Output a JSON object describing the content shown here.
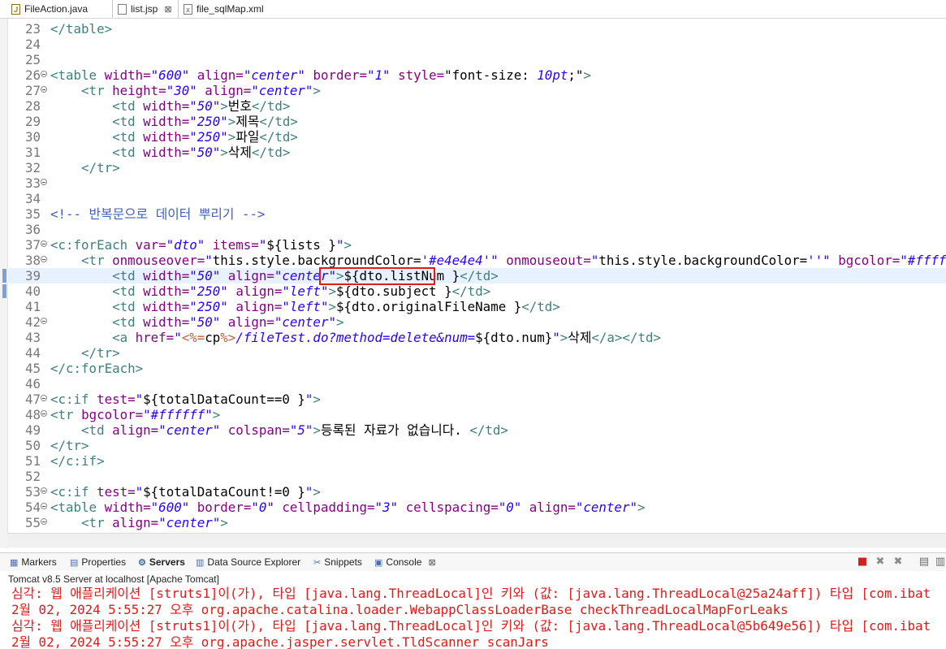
{
  "editor_tabs": [
    {
      "name": "FileAction.java",
      "icon": "java-file-icon",
      "active": false
    },
    {
      "name": "list.jsp",
      "icon": "jsp-file-icon",
      "active": true,
      "close": "⊠"
    },
    {
      "name": "file_sqlMap.xml",
      "icon": "xml-file-icon",
      "active": false
    }
  ],
  "editor": {
    "current_line": 39,
    "highlight_text": "${dto.listNum }",
    "lines": [
      {
        "n": "23",
        "fold": false,
        "html": "<span class='t'>&lt;/table&gt;</span>"
      },
      {
        "n": "24",
        "fold": false,
        "html": ""
      },
      {
        "n": "25",
        "fold": false,
        "html": ""
      },
      {
        "n": "26",
        "fold": true,
        "html": "<span class='t'>&lt;table</span> <span class='a'>width=</span><span class='v'>\"600\"</span> <span class='a'>align=</span><span class='v'>\"center\"</span> <span class='a'>border=</span><span class='v'>\"1\"</span> <span class='a'>style=</span><span class='d'>\"font-size: </span><span class='v'>10pt</span><span class='d'>;\"</span><span class='t'>&gt;</span>"
      },
      {
        "n": "27",
        "fold": true,
        "html": "    <span class='t'>&lt;tr</span> <span class='a'>height=</span><span class='v'>\"30\"</span> <span class='a'>align=</span><span class='v'>\"center\"</span><span class='t'>&gt;</span>"
      },
      {
        "n": "28",
        "fold": false,
        "html": "        <span class='t'>&lt;td</span> <span class='a'>width=</span><span class='v'>\"50\"</span><span class='t'>&gt;</span>번호<span class='t'>&lt;/td&gt;</span>"
      },
      {
        "n": "29",
        "fold": false,
        "html": "        <span class='t'>&lt;td</span> <span class='a'>width=</span><span class='v'>\"250\"</span><span class='t'>&gt;</span>제목<span class='t'>&lt;/td&gt;</span>"
      },
      {
        "n": "30",
        "fold": false,
        "html": "        <span class='t'>&lt;td</span> <span class='a'>width=</span><span class='v'>\"250\"</span><span class='t'>&gt;</span>파일<span class='t'>&lt;/td&gt;</span>"
      },
      {
        "n": "31",
        "fold": false,
        "html": "        <span class='t'>&lt;td</span> <span class='a'>width=</span><span class='v'>\"50\"</span><span class='t'>&gt;</span>삭제<span class='t'>&lt;/td&gt;</span>"
      },
      {
        "n": "32",
        "fold": false,
        "html": "    <span class='t'>&lt;/tr&gt;</span>"
      },
      {
        "n": "33",
        "fold": true,
        "html": ""
      },
      {
        "n": "34",
        "fold": false,
        "html": ""
      },
      {
        "n": "35",
        "fold": false,
        "html": "<span class='c'>&lt;!-- 반복문으로 데이터 뿌리기 --&gt;</span>"
      },
      {
        "n": "36",
        "fold": false,
        "html": ""
      },
      {
        "n": "37",
        "fold": true,
        "html": "<span class='t'>&lt;c:forEach</span> <span class='a'>var=</span><span class='v'>\"dto\"</span> <span class='a'>items=</span><span class='v'>\"</span><span class='d'>${lists }</span><span class='v'>\"</span><span class='t'>&gt;</span>"
      },
      {
        "n": "38",
        "fold": true,
        "html": "    <span class='t'>&lt;tr</span> <span class='a'>onmouseover=</span><span class='v'>\"</span><span class='d'>this.style.backgroundColor=</span><span class='v'>'#e4e4e4'</span><span class='v'>\"</span> <span class='a'>onmouseout=</span><span class='v'>\"</span><span class='d'>this.style.backgroundColor=</span><span class='v'>''</span><span class='v'>\"</span> <span class='a'>bgcolor=</span><span class='v'>\"#ffffff\"</span><span class='t'>&gt;</span>"
      },
      {
        "n": "39",
        "fold": false,
        "html": "        <span class='t'>&lt;td</span> <span class='a'>width=</span><span class='v'>\"50\"</span> <span class='a'>align=</span><span class='v'>\"center\"</span><span class='t'>&gt;</span>${dto.listNum }<span class='t'>&lt;/td&gt;</span>"
      },
      {
        "n": "40",
        "fold": false,
        "html": "        <span class='t'>&lt;td</span> <span class='a'>width=</span><span class='v'>\"250\"</span> <span class='a'>align=</span><span class='v'>\"left\"</span><span class='t'>&gt;</span>${dto.subject }<span class='t'>&lt;/td&gt;</span>"
      },
      {
        "n": "41",
        "fold": false,
        "html": "        <span class='t'>&lt;td</span> <span class='a'>width=</span><span class='v'>\"250\"</span> <span class='a'>align=</span><span class='v'>\"left\"</span><span class='t'>&gt;</span>${dto.originalFileName }<span class='t'>&lt;/td&gt;</span>"
      },
      {
        "n": "42",
        "fold": true,
        "html": "        <span class='t'>&lt;td</span> <span class='a'>width=</span><span class='v'>\"50\"</span> <span class='a'>align=</span><span class='v'>\"center\"</span><span class='t'>&gt;</span>"
      },
      {
        "n": "43",
        "fold": false,
        "html": "        <span class='t'>&lt;a</span> <span class='a'>href=</span><span class='v'>\"</span><span class='k'>&lt;%=</span><span class='d'>cp</span><span class='k'>%&gt;</span><span class='v'>/fileTest.do?method=delete&amp;num=</span><span class='d'>${dto.num}</span><span class='v'>\"</span><span class='t'>&gt;</span>삭제<span class='t'>&lt;/a&gt;&lt;/td&gt;</span>"
      },
      {
        "n": "44",
        "fold": false,
        "html": "    <span class='t'>&lt;/tr&gt;</span>"
      },
      {
        "n": "45",
        "fold": false,
        "html": "<span class='t'>&lt;/c:forEach&gt;</span>"
      },
      {
        "n": "46",
        "fold": false,
        "html": ""
      },
      {
        "n": "47",
        "fold": true,
        "html": "<span class='t'>&lt;c:if</span> <span class='a'>test=</span><span class='v'>\"</span><span class='d'>${totalDataCount==0 }</span><span class='v'>\"</span><span class='t'>&gt;</span>"
      },
      {
        "n": "48",
        "fold": true,
        "html": "<span class='t'>&lt;tr</span> <span class='a'>bgcolor=</span><span class='v'>\"#ffffff\"</span><span class='t'>&gt;</span>"
      },
      {
        "n": "49",
        "fold": false,
        "html": "    <span class='t'>&lt;td</span> <span class='a'>align=</span><span class='v'>\"center\"</span> <span class='a'>colspan=</span><span class='v'>\"5\"</span><span class='t'>&gt;</span>등록된 자료가 없습니다. <span class='t'>&lt;/td&gt;</span>"
      },
      {
        "n": "50",
        "fold": false,
        "html": "<span class='t'>&lt;/tr&gt;</span>"
      },
      {
        "n": "51",
        "fold": false,
        "html": "<span class='t'>&lt;/c:if&gt;</span>"
      },
      {
        "n": "52",
        "fold": false,
        "html": ""
      },
      {
        "n": "53",
        "fold": true,
        "html": "<span class='t'>&lt;c:if</span> <span class='a'>test=</span><span class='v'>\"</span><span class='d'>${totalDataCount!=0 }</span><span class='v'>\"</span><span class='t'>&gt;</span>"
      },
      {
        "n": "54",
        "fold": true,
        "html": "<span class='t'>&lt;table</span> <span class='a'>width=</span><span class='v'>\"600\"</span> <span class='a'>border=</span><span class='v'>\"0\"</span> <span class='a'>cellpadding=</span><span class='v'>\"3\"</span> <span class='a'>cellspacing=</span><span class='v'>\"0\"</span> <span class='a'>align=</span><span class='v'>\"center\"</span><span class='t'>&gt;</span>"
      },
      {
        "n": "55",
        "fold": true,
        "html": "    <span class='t'>&lt;tr</span> <span class='a'>align=</span><span class='v'>\"center\"</span><span class='t'>&gt;</span>"
      }
    ]
  },
  "view_tabs": [
    {
      "name": "Markers",
      "icon": "markers-icon",
      "glyph": "▦"
    },
    {
      "name": "Properties",
      "icon": "properties-icon",
      "glyph": "▤"
    },
    {
      "name": "Servers",
      "icon": "servers-icon",
      "glyph": "⚙",
      "bold": true
    },
    {
      "name": "Data Source Explorer",
      "icon": "data-source-icon",
      "glyph": "▥"
    },
    {
      "name": "Snippets",
      "icon": "snippets-icon",
      "glyph": "✂"
    },
    {
      "name": "Console",
      "icon": "console-icon",
      "glyph": "▣",
      "close": "⊠"
    }
  ],
  "console": {
    "server_label": "Tomcat v8.5 Server at localhost [Apache Tomcat]",
    "lines": [
      "심각: 웹 애플리케이션 [struts1]이(가), 타입 [java.lang.ThreadLocal]인 키와 (값: [java.lang.ThreadLocal@25a24aff]) 타입 [com.ibat",
      "2월 02, 2024 5:55:27 오후 org.apache.catalina.loader.WebappClassLoaderBase checkThreadLocalMapForLeaks",
      "심각: 웹 애플리케이션 [struts1]이(가), 타입 [java.lang.ThreadLocal]인 키와 (값: [java.lang.ThreadLocal@5b649e56]) 타입 [com.ibat",
      "2월 02, 2024 5:55:27 오후 org.apache.jasper.servlet.TldScanner scanJars"
    ],
    "text_color": "#e01a1a"
  },
  "colors": {
    "highlight_box": "#e21a1a",
    "current_line": "#e8f2fe",
    "tag": "#3f7f7f",
    "attr": "#7f007f",
    "value": "#2a00ff",
    "comment": "#3f5fbf"
  }
}
